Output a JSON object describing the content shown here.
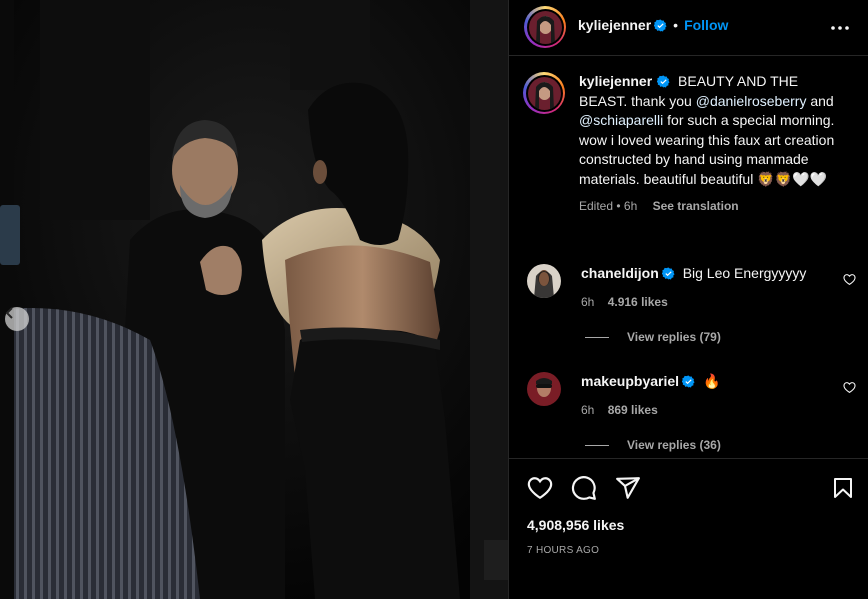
{
  "post": {
    "username": "kyliejenner",
    "follow_label": "Follow",
    "separator": "•",
    "caption": {
      "username": "kyliejenner",
      "text_1": "BEAUTY AND THE BEAST. thank you ",
      "mention_1": "@danielroseberry",
      "text_2": " and ",
      "mention_2": "@schiaparelli",
      "text_3": " for such a special morning. wow i loved wearing this faux art creation constructed by hand using manmade materials. beautiful beautiful ",
      "emoji": "🦁🦁🤍🤍",
      "edited": "Edited • 6h",
      "see_translation": "See translation"
    },
    "comments": [
      {
        "username": "chaneldijon",
        "text": "Big Leo Energyyyyy",
        "time": "6h",
        "likes": "4.916 likes",
        "replies": "View replies (79)"
      },
      {
        "username": "makeupbyariel",
        "text": "🔥",
        "time": "6h",
        "likes": "869 likes",
        "replies": "View replies (36)"
      }
    ],
    "like_count": "4,908,956 likes",
    "posted": "7 HOURS AGO"
  },
  "icons": {
    "verified": "verified-badge-icon",
    "more": "more-options-icon",
    "like": "heart-icon",
    "comment": "comment-icon",
    "share": "share-icon",
    "save": "bookmark-icon",
    "prev": "chevron-left-icon"
  },
  "colors": {
    "follow": "#0095f6",
    "verified": "#0095f6",
    "background": "#000000",
    "secondary_text": "#a8a8a8",
    "divider": "#262626"
  }
}
